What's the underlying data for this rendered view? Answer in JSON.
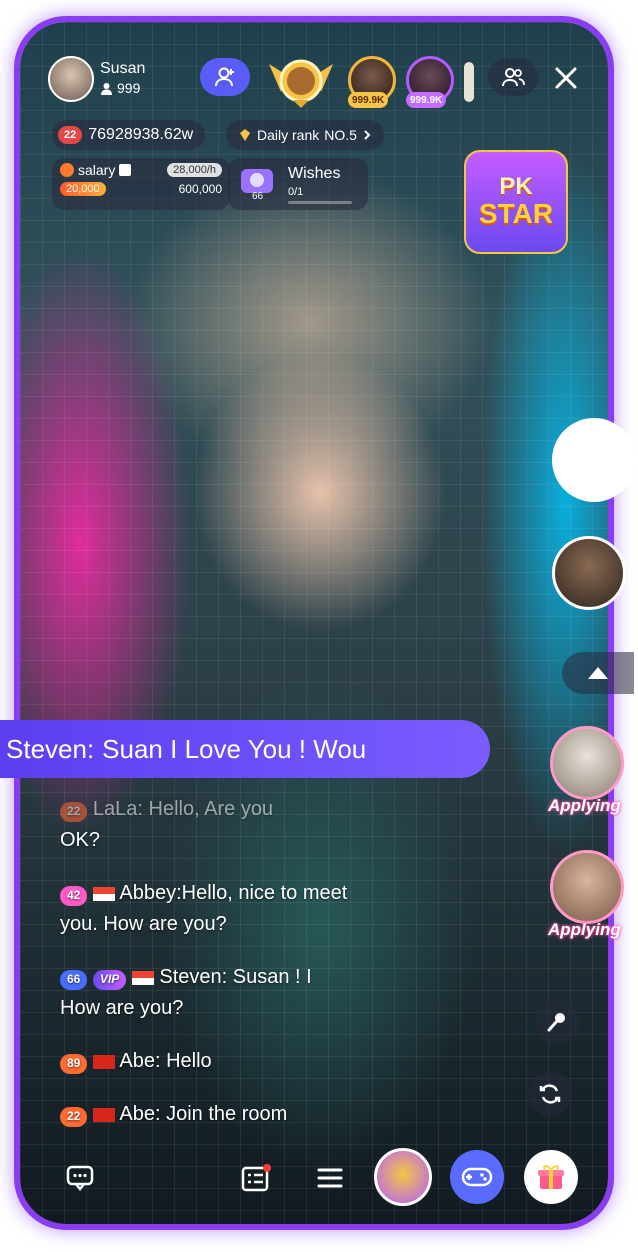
{
  "host": {
    "name": "Susan",
    "fans": "999"
  },
  "top_ranks": [
    {
      "value": "999.9K"
    },
    {
      "value": "999.9K"
    }
  ],
  "coins": {
    "level": "22",
    "amount": "76928938.62w"
  },
  "daily_rank": {
    "label": "Daily rank",
    "value": "NO.5"
  },
  "salary": {
    "label": "salary",
    "rate": "28,000/h",
    "current": "20,000",
    "target": "600,000"
  },
  "wishes": {
    "label": "Wishes",
    "progress": "0/1",
    "progress_fraction": 0,
    "gift_count": "66"
  },
  "pk": {
    "line1": "PK",
    "line2": "STAR"
  },
  "banner": {
    "user": "Steven:",
    "text": "Suan I Love You ! Wou"
  },
  "chat": [
    {
      "level": "22",
      "user": "LaLa:",
      "text": "Hello, Are you",
      "cont": "OK?"
    },
    {
      "level": "42",
      "user": "Abbey:",
      "text": "Hello, nice to meet",
      "cont": "you. How are you?"
    },
    {
      "level": "66",
      "vip": "VIP",
      "user": "Steven:",
      "text": "Susan ! I",
      "cont": "How are you?"
    },
    {
      "level": "89",
      "user": "Abe:",
      "text": "Hello"
    },
    {
      "level": "22",
      "user": "Abe:",
      "text": "Join the room"
    }
  ],
  "applicants": [
    {
      "status": "Applying"
    },
    {
      "status": "Applying"
    }
  ],
  "icons": {
    "add_follow": "user-plus-icon",
    "audience": "users-icon",
    "close": "close-icon",
    "mic": "microphone-icon",
    "flip": "camera-flip-icon",
    "chat": "chat-bubble-icon",
    "tasks": "checklist-icon",
    "menu": "hamburger-menu-icon",
    "game": "gamepad-icon",
    "gift": "gift-box-icon"
  },
  "colors": {
    "frame": "#8a3cf0",
    "banner": "#6c4cf6",
    "badge_level": "#ff6a33",
    "badge_pink": "#ff5ac8",
    "badge_blue": "#4a6cff",
    "applying_glow": "#ff4fa3"
  }
}
